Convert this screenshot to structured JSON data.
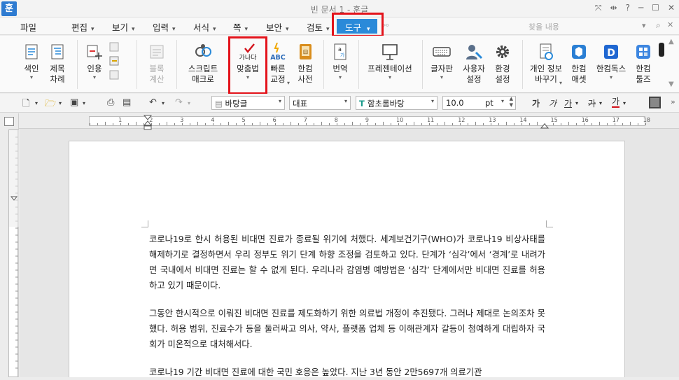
{
  "window": {
    "app_logo": "훈",
    "title": "빈 문서 1 - 훈글"
  },
  "menu": {
    "items": [
      "파일",
      "편집",
      "보기",
      "입력",
      "서식",
      "쪽",
      "보안",
      "검토"
    ],
    "active": "도구",
    "search_placeholder": "찾을 내용"
  },
  "ribbon": {
    "index": "색인",
    "title_order": "제목\n차례",
    "cite": "인용",
    "block_calc": "블록\n계산",
    "script_macro": "스크립트\n매크로",
    "spellcheck": "맞춤법",
    "spellcheck_icon_text": "가나다",
    "quick_correct": "빠른\n교정",
    "quick_correct_icon_text": "ABC",
    "hancom_dict": "한컴\n사전",
    "translate": "번역",
    "presentation": "프레젠테이션",
    "keyboard": "글자판",
    "user_settings": "사용자\n설정",
    "env_settings": "환경\n설정",
    "privacy_change": "개인 정보\n바꾸기",
    "hancom_essay": "한컴\n애셋",
    "hancom_docs": "한컴독스",
    "hancom_tools": "한컴\n툴즈"
  },
  "format_bar": {
    "style": "바탕글",
    "language": "대표",
    "font": "함초롬바탕",
    "size": "10.0",
    "unit": "pt",
    "bold": "가",
    "italic": "가",
    "underline": "가",
    "strike": "가",
    "color": "가"
  },
  "ruler": {
    "numbers": [
      "1",
      "2",
      "3",
      "4",
      "5",
      "6",
      "7",
      "8",
      "9",
      "10",
      "11",
      "12",
      "13",
      "14",
      "15",
      "16",
      "17",
      "18"
    ],
    "corner_label": "L"
  },
  "document": {
    "paragraphs": [
      "코로나19로 한시 허용된 비대면 진료가 종료될 위기에 처했다. 세계보건기구(WHO)가 코로나19 비상사태를 해제하기로 결정하면서 우리 정부도 위기 단계 하향 조정을 검토하고 있다. 단계가 ‘심각’에서 ‘경계’로 내려가면 국내에서 비대면 진료는 할 수 없게 된다. 우리나라 감염병 예방법은 ‘심각’ 단계에서만 비대면 진료를 허용하고 있기 때문이다.",
      "그동안 한시적으로 이뤄진 비대면 진료를 제도화하기 위한 의료법 개정이 추진됐다. 그러나 제대로 논의조차 못했다. 허용 범위, 진료수가 등을 둘러싸고 의사, 약사, 플랫폼 업체 등 이해관계자 갈등이 첨예하게 대립하자 국회가 미온적으로 대처해서다.",
      "코로나19 기간 비대면 진료에 대한 국민 호응은 높았다. 지난 3년 동안 2만5697개 의료기관"
    ]
  },
  "colors": {
    "accent": "#2a8ad9",
    "highlight_box": "#e3131b"
  }
}
